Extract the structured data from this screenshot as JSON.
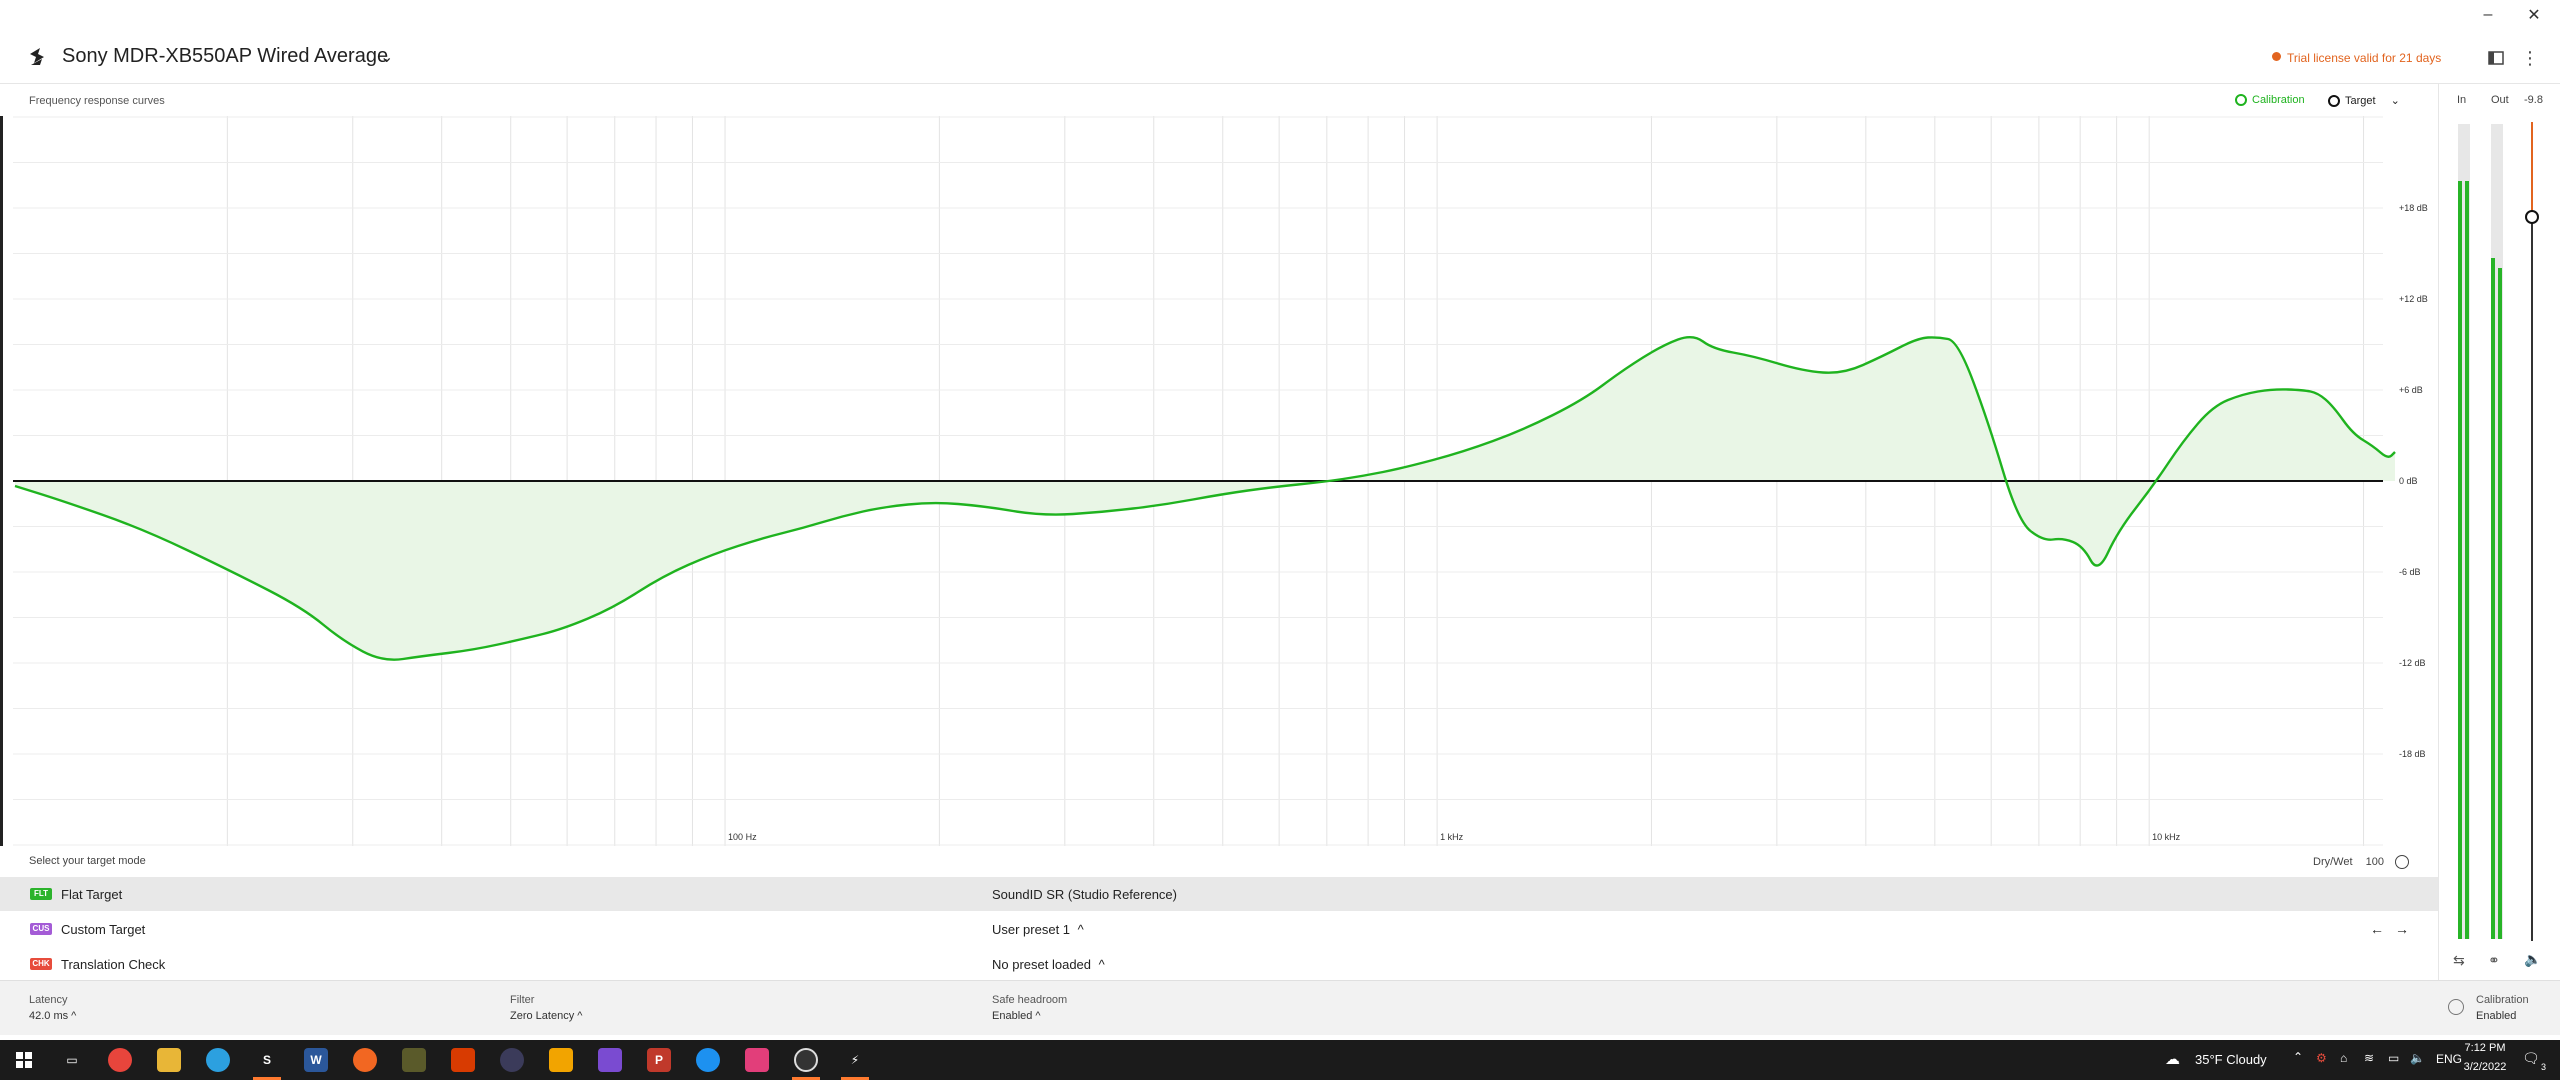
{
  "window": {
    "minimize": "–",
    "close": "✕"
  },
  "header": {
    "device_name": "Sony MDR-XB550AP Wired Average",
    "trial_notice": "Trial license valid for 21 days"
  },
  "graph": {
    "title": "Frequency response curves",
    "legend": {
      "calibration": "Calibration",
      "target": "Target"
    },
    "y_labels": [
      "+18 dB",
      "+12 dB",
      "+6 dB",
      "0 dB",
      "-6 dB",
      "-12 dB",
      "-18 dB"
    ],
    "x_labels": [
      "100 Hz",
      "1 kHz",
      "10 kHz"
    ],
    "colors": {
      "calibration": "#1fb31f",
      "target": "#111111",
      "fill": "#e9f6e6"
    },
    "ylim": [
      -24,
      24
    ]
  },
  "meters": {
    "in_label": "In",
    "out_label": "Out",
    "value": "-9.8",
    "accent": "#e2641f"
  },
  "targets": {
    "prompt": "Select your target mode",
    "drywet_label": "Dry/Wet",
    "drywet_value": "100",
    "rows": [
      {
        "badge": "FLT",
        "badge_color": "#2bb32b",
        "label": "Flat Target",
        "preset": "SoundID SR (Studio Reference)",
        "preset_caret": ""
      },
      {
        "badge": "CUS",
        "badge_color": "#a45bd6",
        "label": "Custom Target",
        "preset": "User preset 1",
        "preset_caret": "^"
      },
      {
        "badge": "CHK",
        "badge_color": "#e74c3c",
        "label": "Translation Check",
        "preset": "No preset loaded",
        "preset_caret": "^"
      }
    ]
  },
  "footer": {
    "latency_label": "Latency",
    "latency_value": "42.0 ms ^",
    "filter_label": "Filter",
    "filter_value": "Zero Latency ^",
    "headroom_label": "Safe headroom",
    "headroom_value": "Enabled ^",
    "calibration_label": "Calibration",
    "calibration_value": "Enabled"
  },
  "taskbar": {
    "weather": "35°F  Cloudy",
    "language": "ENG",
    "time": "7:12 PM",
    "date": "3/2/2022",
    "notifications": "3"
  }
}
